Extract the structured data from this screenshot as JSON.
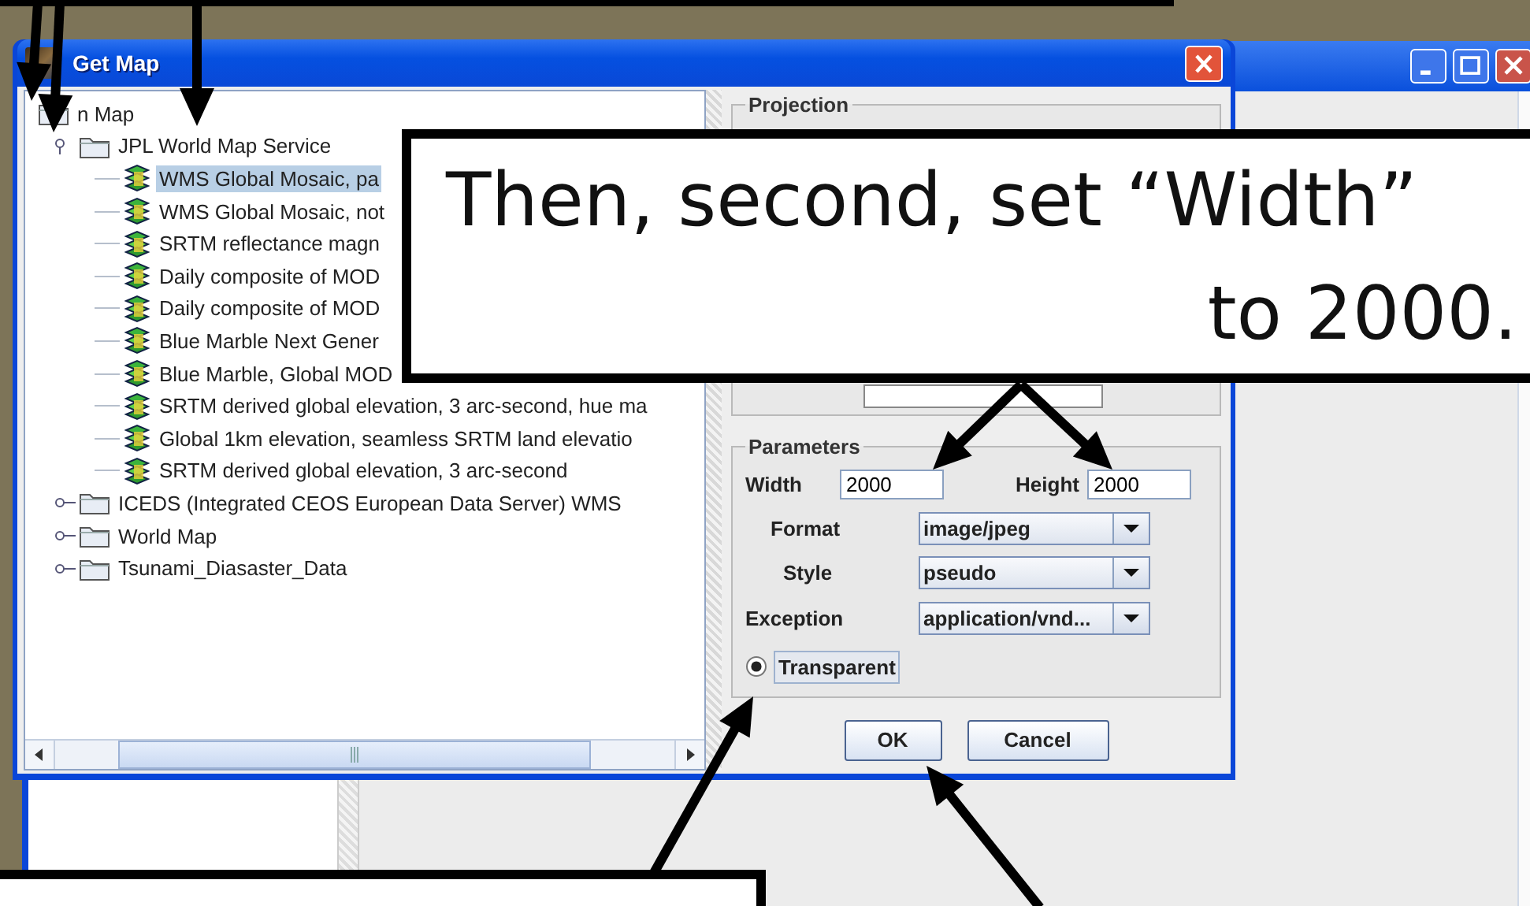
{
  "dialog": {
    "title": "Get Map"
  },
  "tree": {
    "items": [
      {
        "label": "n Map",
        "children": [
          {
            "label": "JPL World Map Service",
            "expanded": true,
            "children": [
              {
                "label": "WMS Global Mosaic, pa",
                "selected": true
              },
              {
                "label": "WMS Global Mosaic, not",
                "selected": false
              },
              {
                "label": "SRTM reflectance magn",
                "selected": false
              },
              {
                "label": "Daily composite of MOD",
                "selected": false
              },
              {
                "label": "Daily composite of MOD",
                "selected": false
              },
              {
                "label": "Blue Marble Next Gener",
                "selected": false
              },
              {
                "label": "Blue Marble, Global MOD",
                "selected": false
              },
              {
                "label": "SRTM derived global elevation, 3 arc-second, hue ma",
                "selected": false
              },
              {
                "label": "Global 1km elevation, seamless SRTM land elevatio",
                "selected": false
              },
              {
                "label": "SRTM derived global elevation, 3 arc-second",
                "selected": false
              }
            ]
          },
          {
            "label": "ICEDS (Integrated CEOS European Data Server) WMS",
            "expanded": false
          },
          {
            "label": "World Map",
            "expanded": false
          },
          {
            "label": "Tsunami_Diasaster_Data",
            "expanded": false
          }
        ]
      }
    ]
  },
  "projection": {
    "legend": "Projection"
  },
  "parameters": {
    "legend": "Parameters",
    "width": {
      "label": "Width",
      "value": "2000"
    },
    "height": {
      "label": "Height",
      "value": "2000"
    },
    "dropdowns": [
      {
        "label": "Format",
        "value": "image/jpeg"
      },
      {
        "label": "Style",
        "value": "pseudo"
      },
      {
        "label": "Exception",
        "value": "application/vnd..."
      }
    ],
    "transparent": {
      "label": "Transparent",
      "checked": true
    }
  },
  "buttons": [
    "OK",
    "Cancel"
  ],
  "callout": {
    "lines": [
      "Then, second, set “Width”",
      "to 2000."
    ]
  }
}
